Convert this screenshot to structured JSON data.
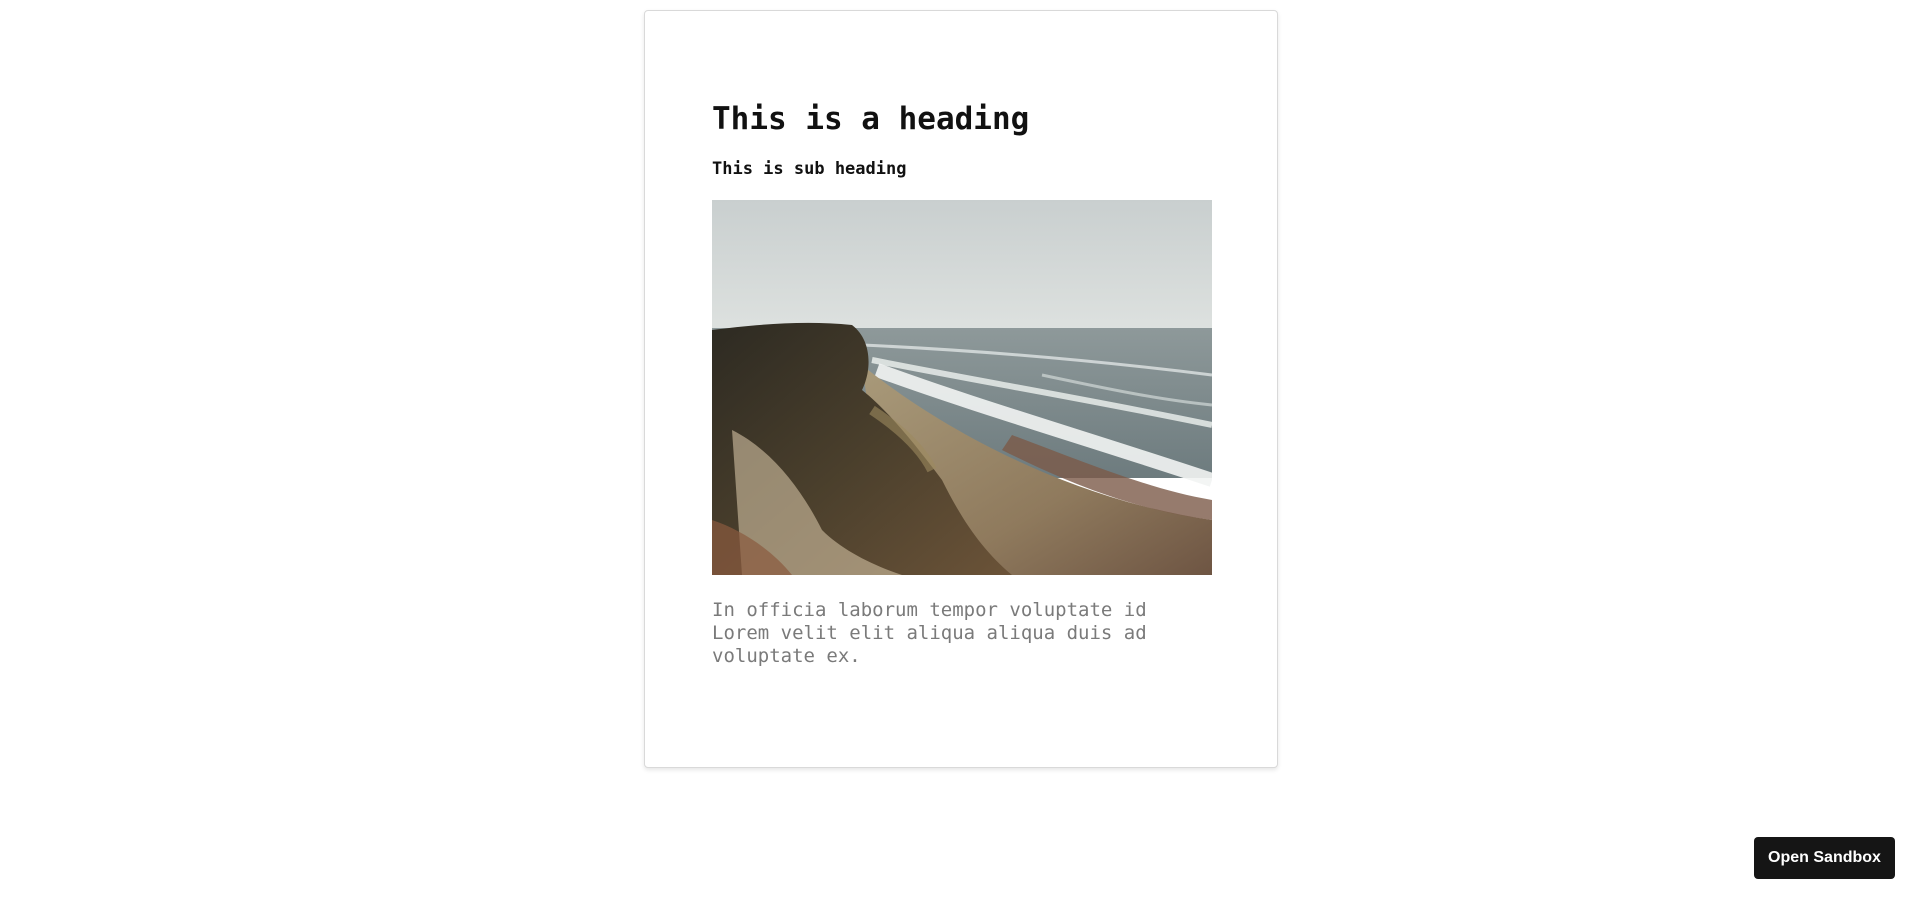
{
  "card": {
    "heading": "This is a heading",
    "subheading": "This is sub heading",
    "image_alt": "coastal cliff overlooking beach and sea",
    "body": "In officia laborum tempor voluptate id Lorem velit elit aliqua aliqua duis ad voluptate ex."
  },
  "sandbox_button": {
    "label": "Open Sandbox"
  }
}
